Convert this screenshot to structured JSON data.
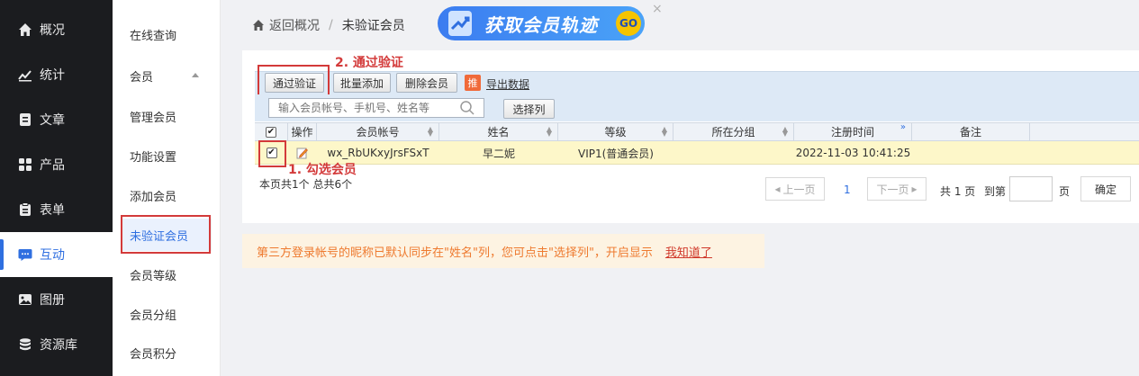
{
  "nav": {
    "items": [
      {
        "label": "概况",
        "icon": "home-icon"
      },
      {
        "label": "统计",
        "icon": "chart-icon"
      },
      {
        "label": "文章",
        "icon": "article-icon"
      },
      {
        "label": "产品",
        "icon": "product-icon"
      },
      {
        "label": "表单",
        "icon": "form-icon"
      },
      {
        "label": "互动",
        "icon": "chat-icon"
      },
      {
        "label": "图册",
        "icon": "album-icon"
      },
      {
        "label": "资源库",
        "icon": "database-icon"
      }
    ],
    "active_index": 5
  },
  "subnav": {
    "items": [
      "在线查询",
      "会员",
      "管理会员",
      "功能设置",
      "添加会员",
      "未验证会员",
      "会员等级",
      "会员分组",
      "会员积分"
    ],
    "selected": "未验证会员"
  },
  "breadcrumb": {
    "back": "返回概况",
    "separator": "/",
    "current": "未验证会员"
  },
  "banner": {
    "text": "获取会员轨迹",
    "go": "GO",
    "close": "×"
  },
  "toolbar": {
    "verify": "通过验证",
    "batch_add": "批量添加",
    "delete": "删除会员",
    "recommend_badge": "推",
    "export": "导出数据",
    "search_placeholder": "输入会员帐号、手机号、姓名等",
    "select_columns": "选择列"
  },
  "table": {
    "headers": [
      "操作",
      "会员帐号",
      "姓名",
      "等级",
      "所在分组",
      "注册时间",
      "备注"
    ],
    "rows": [
      {
        "account": "wx_RbUKxyJrsFSxT",
        "name": "早二妮",
        "level": "VIP1(普通会员)",
        "group": "",
        "registered": "2022-11-03 10:41:25",
        "note": "",
        "checked": true
      }
    ]
  },
  "annotations": {
    "step1": "1. 勾选会员",
    "step2": "2. 通过验证"
  },
  "pagination": {
    "summary": "本页共1个 总共6个",
    "prev": "上一页",
    "current_page": "1",
    "next": "下一页",
    "total": "共 1 页",
    "goto": "到第",
    "page_unit": "页",
    "confirm": "确定"
  },
  "notice": {
    "text": "第三方登录帐号的昵称已默认同步在\"姓名\"列，您可点击\"选择列\"，开启显示",
    "link": "我知道了"
  },
  "colors": {
    "accent": "#2f6fe0",
    "annotation": "#d33a3a",
    "row_highlight": "#fdf7c9",
    "notice_text": "#ee7a2f"
  }
}
